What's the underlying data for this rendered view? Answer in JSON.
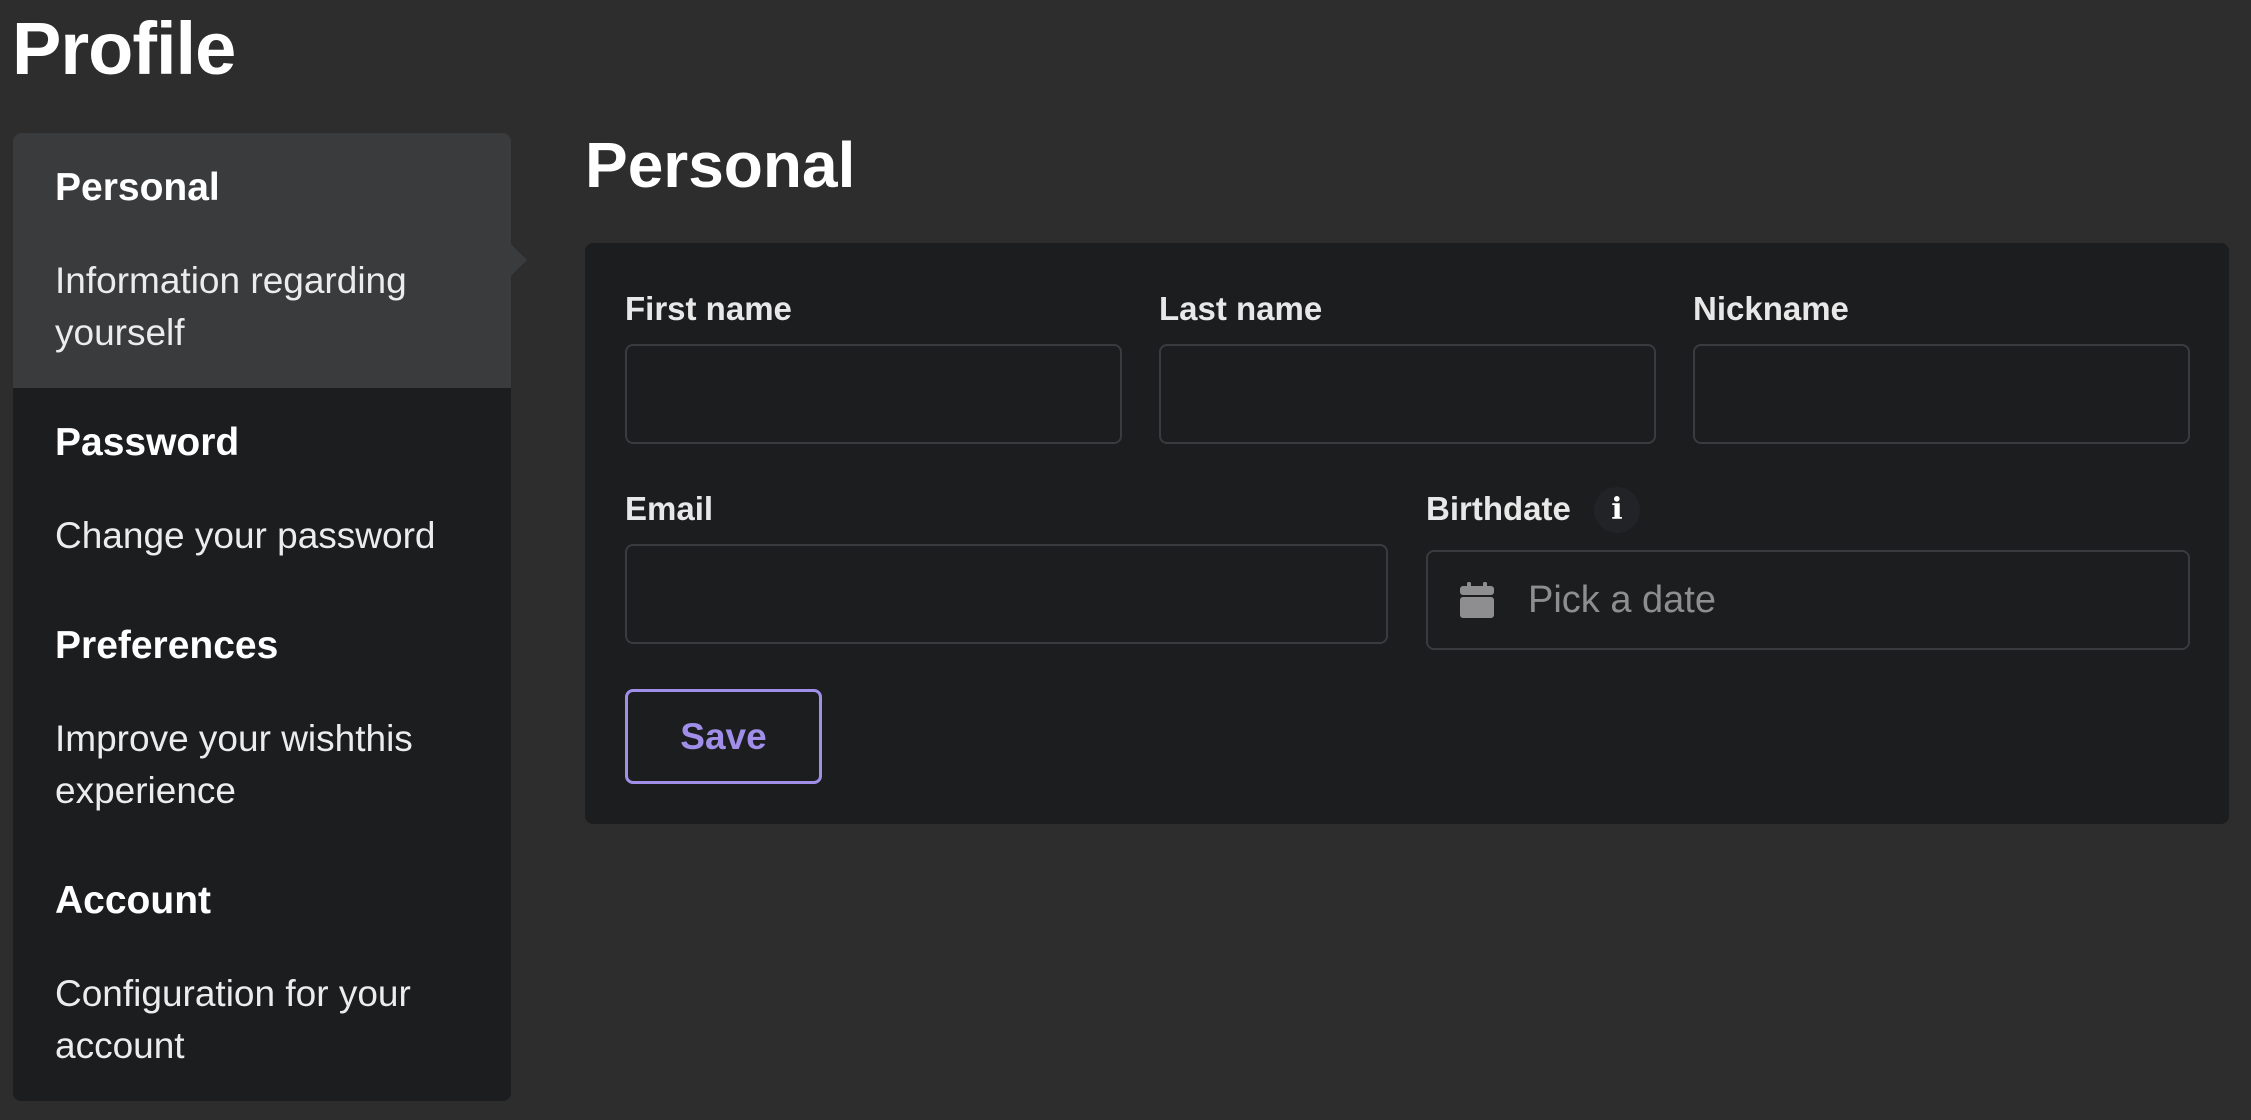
{
  "page": {
    "title": "Profile"
  },
  "sidebar": {
    "items": [
      {
        "title": "Personal",
        "description": "Information regarding yourself",
        "active": true
      },
      {
        "title": "Password",
        "description": "Change your password",
        "active": false
      },
      {
        "title": "Preferences",
        "description": "Improve your wishthis experience",
        "active": false
      },
      {
        "title": "Account",
        "description": "Configuration for your account",
        "active": false
      }
    ]
  },
  "main": {
    "section_title": "Personal",
    "form": {
      "first_name": {
        "label": "First name",
        "value": ""
      },
      "last_name": {
        "label": "Last name",
        "value": ""
      },
      "nickname": {
        "label": "Nickname",
        "value": ""
      },
      "email": {
        "label": "Email",
        "value": ""
      },
      "birthdate": {
        "label": "Birthdate",
        "placeholder": "Pick a date",
        "info_icon": "info-icon",
        "calendar_icon": "calendar-icon"
      },
      "save_label": "Save"
    }
  },
  "colors": {
    "background": "#2d2d2d",
    "panel": "#1c1d1f",
    "active_item": "#3a3b3d",
    "accent": "#a08ee8",
    "placeholder": "#8e8e90"
  }
}
